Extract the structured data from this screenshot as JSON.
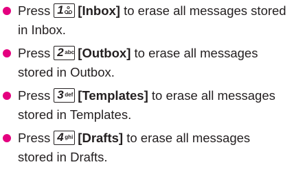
{
  "items": [
    {
      "pre": "Press",
      "key_num": "1",
      "key_sub": "",
      "key_icon": "voicemail-icon",
      "label": "[Inbox]",
      "line1_rest": "to erase all messages stored",
      "line2": "in Inbox."
    },
    {
      "pre": "Press",
      "key_num": "2",
      "key_sub": "abc",
      "label": "[Outbox]",
      "line1_rest": "to erase all messages",
      "line2": "stored in Outbox."
    },
    {
      "pre": "Press",
      "key_num": "3",
      "key_sub": "def",
      "label": "[Templates]",
      "line1_rest": "to erase all messages",
      "line2": "stored in Templates."
    },
    {
      "pre": "Press",
      "key_num": "4",
      "key_sub": "ghi",
      "label": "[Drafts]",
      "line1_rest": "to erase all messages",
      "line2": "stored in Drafts."
    }
  ],
  "colors": {
    "bullet": "#e4007f",
    "text": "#231f20"
  }
}
